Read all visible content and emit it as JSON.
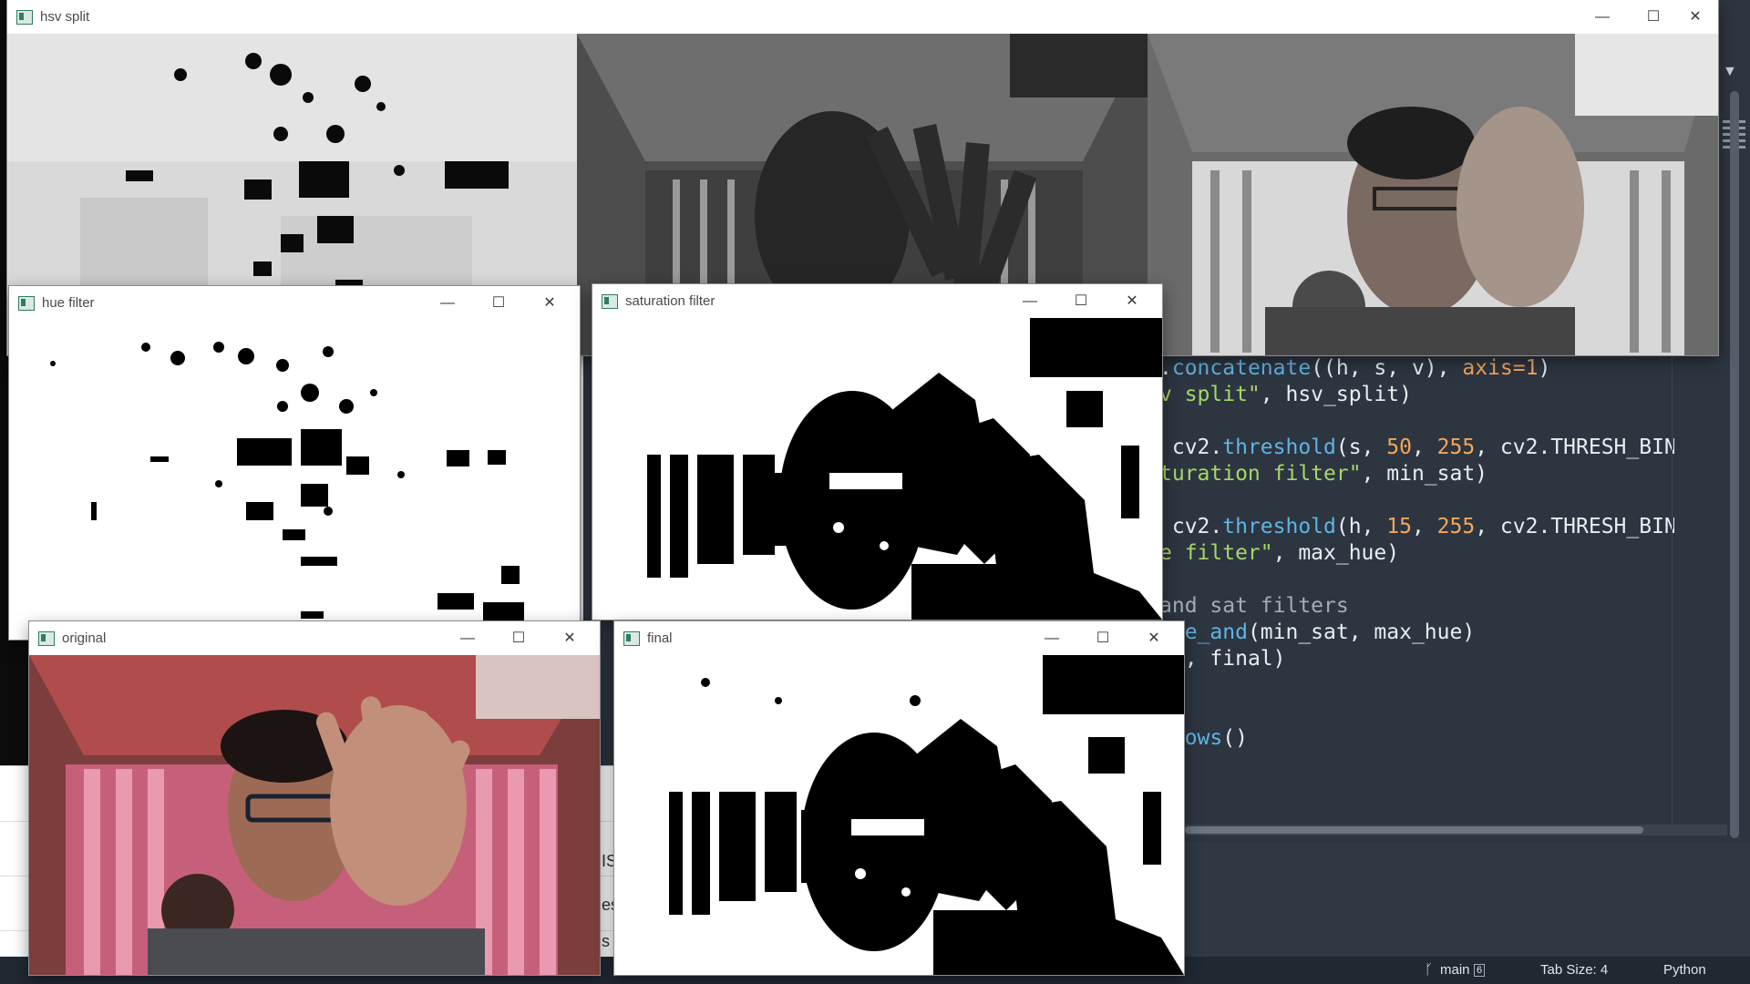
{
  "editor": {
    "code_lines": [
      [
        {
          "t": ".",
          "c": ""
        },
        {
          "t": "concatenate",
          "c": "kw"
        },
        {
          "t": "((h, s, v), ",
          "c": ""
        },
        {
          "t": "axis",
          "c": "num"
        },
        {
          "t": "=",
          "c": "num"
        },
        {
          "t": "1",
          "c": "num"
        },
        {
          "t": ")",
          "c": ""
        }
      ],
      [
        {
          "t": "v split\"",
          "c": "str"
        },
        {
          "t": ", hsv_split)",
          "c": ""
        }
      ],
      [],
      [
        {
          "t": " cv2.",
          "c": ""
        },
        {
          "t": "threshold",
          "c": "kw"
        },
        {
          "t": "(s, ",
          "c": ""
        },
        {
          "t": "50",
          "c": "num"
        },
        {
          "t": ", ",
          "c": ""
        },
        {
          "t": "255",
          "c": "num"
        },
        {
          "t": ", cv2.THRESH_BIN",
          "c": ""
        }
      ],
      [
        {
          "t": "turation filter\"",
          "c": "str"
        },
        {
          "t": ", min_sat)",
          "c": ""
        }
      ],
      [],
      [
        {
          "t": " cv2.",
          "c": ""
        },
        {
          "t": "threshold",
          "c": "kw"
        },
        {
          "t": "(h, ",
          "c": ""
        },
        {
          "t": "15",
          "c": "num"
        },
        {
          "t": ", ",
          "c": ""
        },
        {
          "t": "255",
          "c": "num"
        },
        {
          "t": ", cv2.THRESH_BIN",
          "c": ""
        }
      ],
      [
        {
          "t": "e filter\"",
          "c": "str"
        },
        {
          "t": ", max_hue)",
          "c": ""
        }
      ],
      [],
      [
        {
          "t": "and sat filters",
          "c": "cmt"
        }
      ],
      [
        {
          "t": "ise_and",
          "c": "kw"
        },
        {
          "t": "(min_sat, max_hue)",
          "c": ""
        }
      ],
      [
        {
          "t": "l\"",
          "c": "str"
        },
        {
          "t": ", final)",
          "c": ""
        }
      ],
      [],
      [],
      [
        {
          "t": "ndows",
          "c": "kw"
        },
        {
          "t": "()",
          "c": ""
        }
      ]
    ],
    "side_fragments": [
      "IS",
      "es",
      "s"
    ]
  },
  "statusbar": {
    "branch": "main",
    "branch_count": "6",
    "tab_size": "Tab Size: 4",
    "language": "Python"
  },
  "windows": {
    "hsv_split": {
      "title": "hsv split"
    },
    "hue_filter": {
      "title": "hue filter"
    },
    "saturation_filter": {
      "title": "saturation filter"
    },
    "original": {
      "title": "original"
    },
    "final": {
      "title": "final"
    }
  },
  "controls": {
    "minimize": "—",
    "maximize": "☐",
    "close": "✕"
  },
  "colors": {
    "editor_bg": "#2d3540",
    "accent_icon": "#2e7d5f",
    "keyword": "#5fb4e4",
    "string": "#a6d66a",
    "number": "#f5a65b"
  }
}
